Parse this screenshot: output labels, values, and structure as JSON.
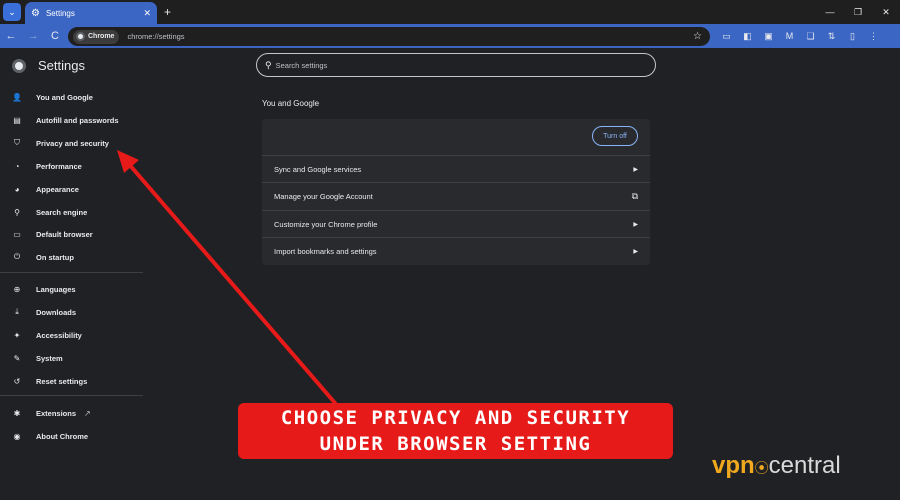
{
  "tab": {
    "title": "Settings",
    "close": "✕",
    "new_tab": "+"
  },
  "window_controls": [
    "—",
    "❐",
    "✕"
  ],
  "toolbar": {
    "back": "←",
    "forward": "→",
    "reload": "C",
    "site_chip": "Chrome",
    "url": "chrome://settings",
    "star": "☆"
  },
  "extensions": [
    "▭",
    "◧",
    "▣",
    "M",
    "❏",
    "⇅",
    "▯",
    "⋮"
  ],
  "page": {
    "title": "Settings"
  },
  "sidebar": {
    "items": [
      {
        "label": "You and Google",
        "icon": "person-icon",
        "glyph": "👤"
      },
      {
        "label": "Autofill and passwords",
        "icon": "clipboard-icon",
        "glyph": "▤"
      },
      {
        "label": "Privacy and security",
        "icon": "shield-icon",
        "glyph": "⛉"
      },
      {
        "label": "Performance",
        "icon": "gauge-icon",
        "glyph": "◔"
      },
      {
        "label": "Appearance",
        "icon": "palette-icon",
        "glyph": "◕"
      },
      {
        "label": "Search engine",
        "icon": "search-icon",
        "glyph": "⚲"
      },
      {
        "label": "Default browser",
        "icon": "browser-icon",
        "glyph": "▭"
      },
      {
        "label": "On startup",
        "icon": "power-icon",
        "glyph": "⏻"
      },
      {
        "label": "Languages",
        "icon": "globe-icon",
        "glyph": "⊕"
      },
      {
        "label": "Downloads",
        "icon": "download-icon",
        "glyph": "⤓"
      },
      {
        "label": "Accessibility",
        "icon": "accessibility-icon",
        "glyph": "✦"
      },
      {
        "label": "System",
        "icon": "wrench-icon",
        "glyph": "✎"
      },
      {
        "label": "Reset settings",
        "icon": "reset-icon",
        "glyph": "↺"
      },
      {
        "label": "Extensions",
        "icon": "puzzle-icon",
        "glyph": "✱"
      },
      {
        "label": "About Chrome",
        "icon": "chrome-icon",
        "glyph": "◉"
      }
    ]
  },
  "search": {
    "placeholder": "Search settings"
  },
  "section": {
    "title": "You and Google",
    "turn_off": "Turn off",
    "rows": [
      {
        "label": "Sync and Google services",
        "icon": "triangle-right-icon"
      },
      {
        "label": "Manage your Google Account",
        "icon": "open-external-icon"
      },
      {
        "label": "Customize your Chrome profile",
        "icon": "triangle-right-icon"
      },
      {
        "label": "Import bookmarks and settings",
        "icon": "triangle-right-icon"
      }
    ]
  },
  "annotation": {
    "line1": "CHOOSE PRIVACY AND SECURITY",
    "line2": "UNDER BROWSER SETTING",
    "color": "#e61a19"
  },
  "brand": {
    "vpn": "vpn",
    "central": "central"
  }
}
